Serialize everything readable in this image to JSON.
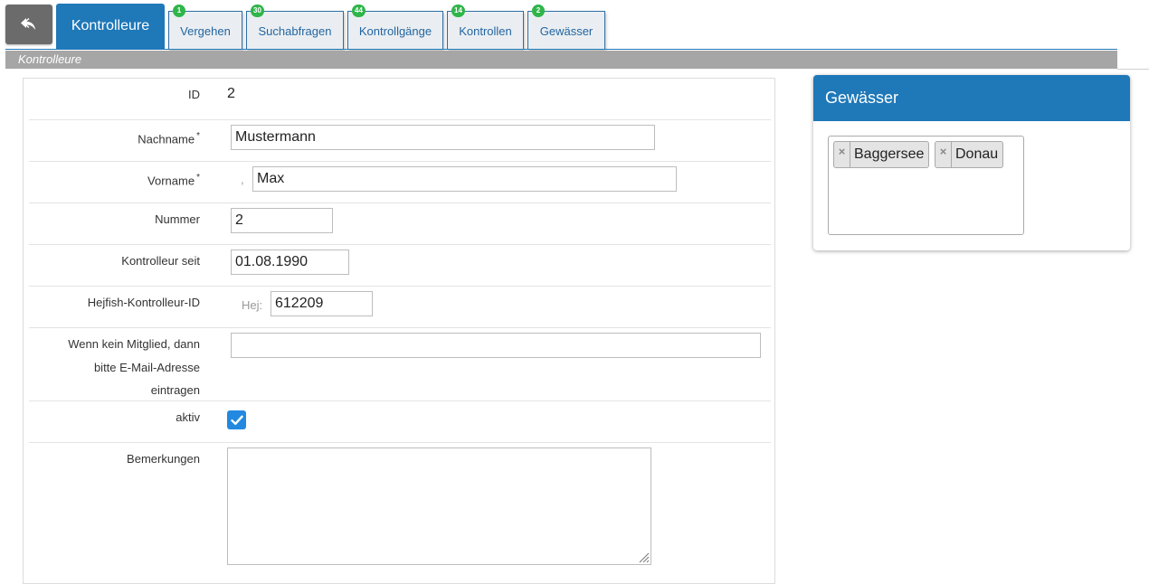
{
  "nav": {
    "back_icon": "reply-arrow-icon",
    "active_tab": "Kontrolleure",
    "tabs": [
      {
        "label": "Vergehen",
        "badge": "1"
      },
      {
        "label": "Suchabfragen",
        "badge": "30"
      },
      {
        "label": "Kontrollgänge",
        "badge": "44"
      },
      {
        "label": "Kontrollen",
        "badge": "14"
      },
      {
        "label": "Gewässer",
        "badge": "2"
      }
    ]
  },
  "section": {
    "title": "Kontrolleure"
  },
  "form": {
    "id": {
      "label": "ID",
      "value": "2"
    },
    "nachname": {
      "label": "Nachname",
      "required_mark": "*",
      "value": "Mustermann"
    },
    "vorname": {
      "label": "Vorname",
      "required_mark": "*",
      "prefix": ",",
      "value": "Max"
    },
    "nummer": {
      "label": "Nummer",
      "value": "2"
    },
    "seit": {
      "label": "Kontrolleur seit",
      "value": "01.08.1990"
    },
    "hejfish": {
      "label": "Hejfish-Kontrolleur-ID",
      "prefix": "Hej:",
      "value": "612209"
    },
    "email": {
      "label_lines": [
        "Wenn kein Mitglied, dann",
        "bitte E-Mail-Adresse",
        "eintragen"
      ],
      "value": ""
    },
    "aktiv": {
      "label": "aktiv",
      "checked": true
    },
    "bemerkungen": {
      "label": "Bemerkungen",
      "value": ""
    }
  },
  "side": {
    "title": "Gewässer",
    "tags": [
      "Baggersee",
      "Donau"
    ],
    "remove_symbol": "×"
  },
  "colors": {
    "primary": "#1f78b8",
    "badge": "#2fb54a",
    "section_bar": "#a6a6a6",
    "checkbox": "#2389e0"
  }
}
